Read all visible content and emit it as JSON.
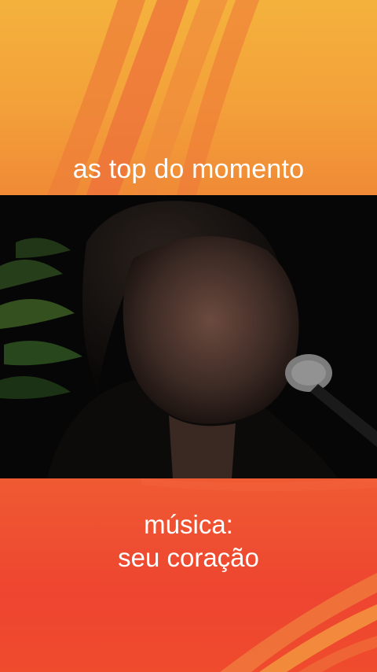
{
  "banner": {
    "title": "as top do momento"
  },
  "video": {
    "description": ""
  },
  "caption": {
    "line1": "música:",
    "line2": "seu coração"
  },
  "colors": {
    "top_banner": "#f3a03a",
    "bottom_banner": "#ee4530",
    "text": "#ffffff"
  }
}
